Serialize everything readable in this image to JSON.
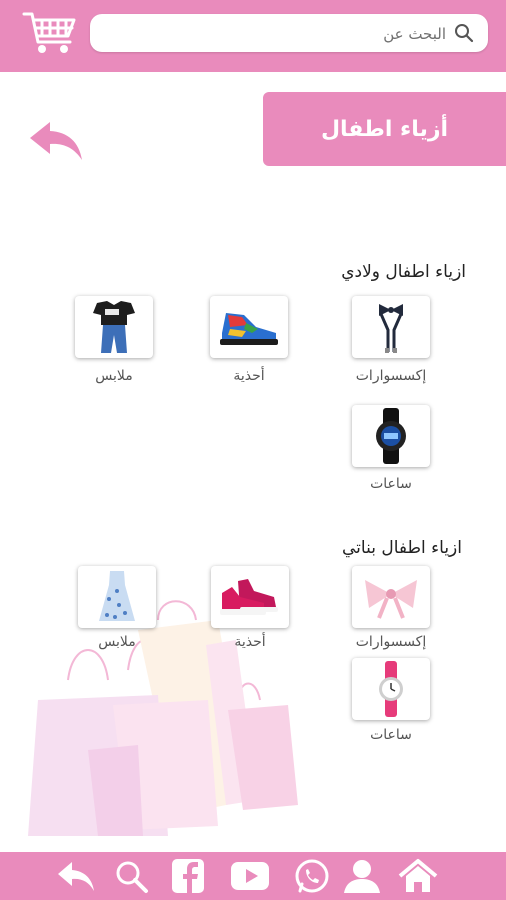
{
  "colors": {
    "accent": "#e98bbc",
    "bags": "#f4c9e1"
  },
  "header": {
    "cart_icon": "shopping-cart-icon",
    "search": {
      "placeholder": "البحث عن",
      "icon": "search-icon"
    }
  },
  "page": {
    "title": "أزياء اطفال",
    "back_icon": "back-arrow-icon"
  },
  "sections": [
    {
      "title": "ازياء اطفال ولادي",
      "items": [
        {
          "label": "إكسسوارات",
          "icon": "suspenders-bowtie-image"
        },
        {
          "label": "أحذية",
          "icon": "sneaker-image"
        },
        {
          "label": "ملابس",
          "icon": "tshirt-jeans-image"
        },
        {
          "label": "ساعات",
          "icon": "digital-watch-image"
        }
      ]
    },
    {
      "title": "ازياء اطفال بناتي",
      "items": [
        {
          "label": "إكسسوارات",
          "icon": "hair-bow-image"
        },
        {
          "label": "أحذية",
          "icon": "pink-sneaker-image"
        },
        {
          "label": "ملابس",
          "icon": "floral-dress-image"
        },
        {
          "label": "ساعات",
          "icon": "pink-watch-image"
        }
      ]
    }
  ],
  "bottom_nav": [
    "reply-arrow-icon",
    "search-icon",
    "facebook-icon",
    "youtube-icon",
    "whatsapp-icon",
    "profile-icon",
    "home-icon"
  ]
}
